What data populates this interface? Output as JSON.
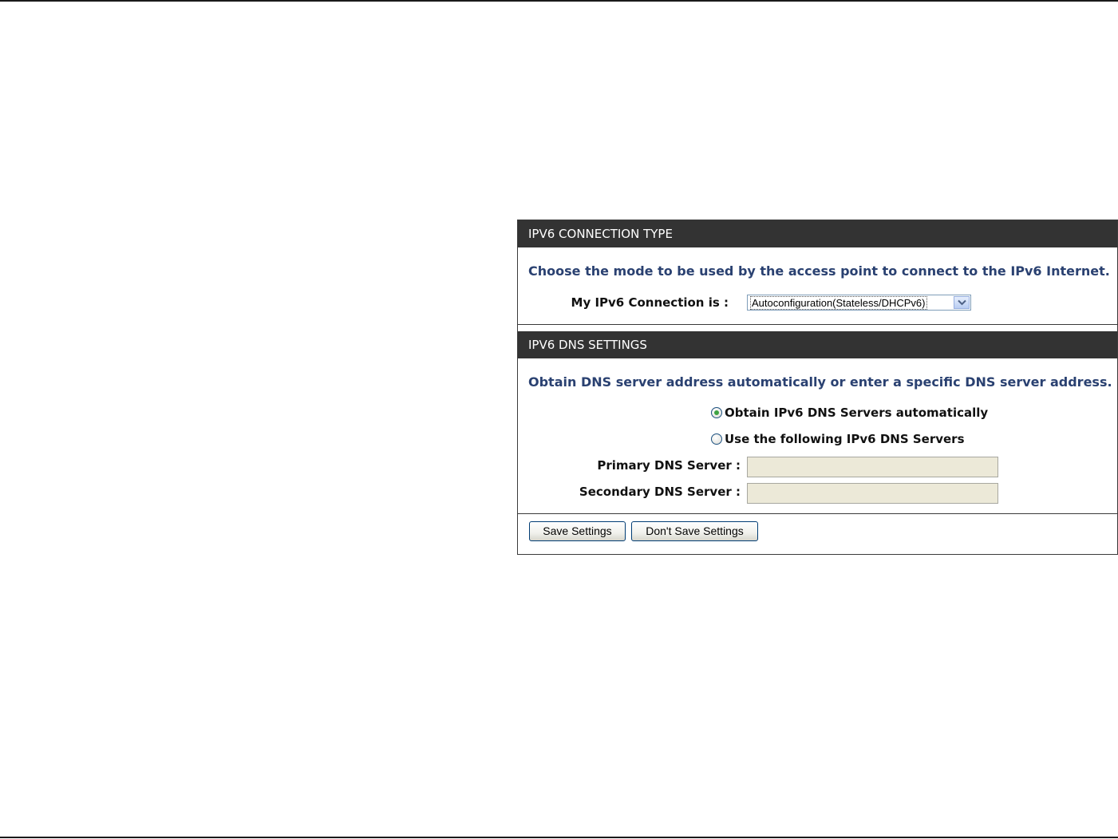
{
  "connection_section": {
    "header": "IPV6 CONNECTION TYPE",
    "intro": "Choose the mode to be used by the access point to connect to the IPv6 Internet.",
    "connection_label": "My IPv6 Connection is :",
    "connection_value": "Autoconfiguration(Stateless/DHCPv6)"
  },
  "dns_section": {
    "header": "IPV6 DNS SETTINGS",
    "intro": "Obtain DNS server address automatically or enter a specific DNS server address.",
    "options": [
      {
        "label": "Obtain IPv6 DNS Servers automatically",
        "selected": true
      },
      {
        "label": "Use the following IPv6 DNS Servers",
        "selected": false
      }
    ],
    "primary_label": "Primary DNS Server :",
    "primary_value": "",
    "secondary_label": "Secondary DNS Server :",
    "secondary_value": ""
  },
  "actions": {
    "save_label": "Save Settings",
    "dont_save_label": "Don't Save Settings"
  },
  "colors": {
    "header_bg": "#333333",
    "intro_text": "#2a4171",
    "radio_checked": "#3ea343"
  }
}
